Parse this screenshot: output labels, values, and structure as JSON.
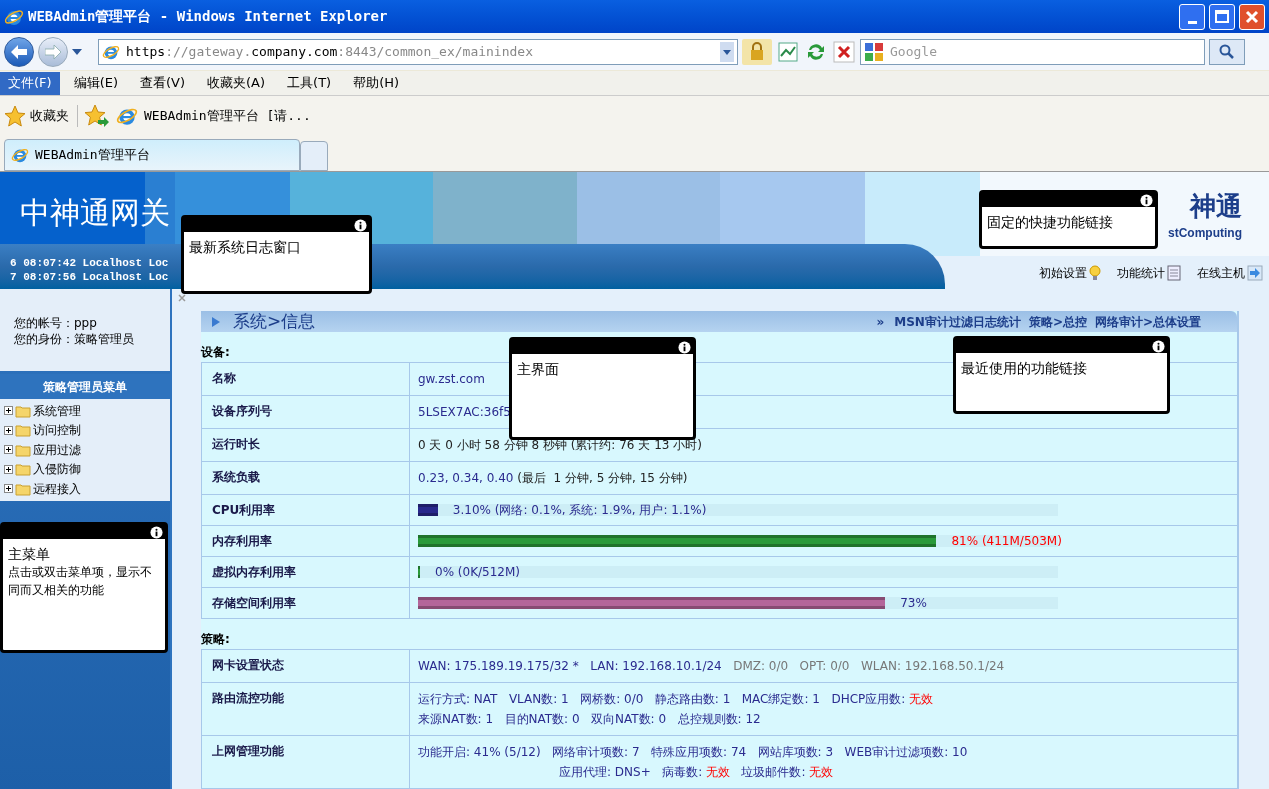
{
  "window": {
    "title": "WEBAdmin管理平台 - Windows Internet Explorer"
  },
  "address": {
    "parts": [
      {
        "text": "https",
        "dim": false
      },
      {
        "text": "://gateway.",
        "dim": true
      },
      {
        "text": "company.com",
        "dim": false
      },
      {
        "text": ":8443/common_ex/mainindex",
        "dim": true
      }
    ]
  },
  "search": {
    "placeholder": "Google"
  },
  "menu": [
    {
      "label": "文件(F)",
      "selected": true
    },
    {
      "label": "编辑(E)",
      "selected": false
    },
    {
      "label": "查看(V)",
      "selected": false
    },
    {
      "label": "收藏夹(A)",
      "selected": false
    },
    {
      "label": "工具(T)",
      "selected": false
    },
    {
      "label": "帮助(H)",
      "selected": false
    }
  ],
  "favorites_bar": {
    "label": "收藏夹",
    "link": "WEBAdmin管理平台 [请..."
  },
  "tabs": [
    {
      "label": "WEBAdmin管理平台",
      "selected": true
    }
  ],
  "header": {
    "brand": "中神通网关",
    "log_lines": [
      "6 08:07:42 Localhost Loc",
      "7 08:07:56 Localhost Loc"
    ],
    "logo_mark": "神通",
    "logo_text": "stComputing",
    "quick_links": [
      {
        "label": "初始设置",
        "kind": "bulb"
      },
      {
        "label": "功能统计",
        "kind": "doc"
      },
      {
        "label": "在线主机",
        "kind": "arrow"
      }
    ]
  },
  "sidebar": {
    "account": [
      "您的帐号：ppp",
      "您的身份：策略管理员"
    ],
    "menu_title": "策略管理员菜单",
    "items": [
      {
        "label": "系统管理",
        "expanded": false
      },
      {
        "label": "访问控制",
        "expanded": false
      },
      {
        "label": "应用过滤",
        "expanded": false
      },
      {
        "label": "入侵防御",
        "expanded": false
      },
      {
        "label": "远程接入",
        "expanded": false
      }
    ]
  },
  "main": {
    "title": "系统>信息",
    "recent_marker": "»",
    "recent_links": [
      "MSN审计过滤日志统计",
      "策略>总控",
      "网络审计>总体设置"
    ],
    "sections": [
      {
        "heading": "设备:",
        "rows": [
          {
            "label": "名称",
            "kind": "text",
            "lines": [
              {
                "segments": [
                  {
                    "text": "gw.zst.com",
                    "kind": "value"
                  }
                ]
              }
            ]
          },
          {
            "label": "设备序列号",
            "kind": "text",
            "lines": [
              {
                "segments": [
                  {
                    "text": "5LSEX7AC:36f5",
                    "kind": "value"
                  }
                ]
              }
            ]
          },
          {
            "label": "运行时长",
            "kind": "text",
            "lines": [
              {
                "segments": [
                  {
                    "text": "0 天 0 小时 58 分钟 8 秒钟 (累计约: 76 天 13 小时)",
                    "kind": "plain"
                  }
                ]
              }
            ]
          },
          {
            "label": "系统负载",
            "kind": "text",
            "lines": [
              {
                "segments": [
                  {
                    "text": "0.23, 0.34, 0.40",
                    "kind": "value"
                  },
                  {
                    "text": " (最后  1 分钟, 5 分钟, 15 分钟)",
                    "kind": "plain"
                  }
                ]
              }
            ]
          },
          {
            "label": "CPU利用率",
            "kind": "meter",
            "level": 0.031,
            "color": "#28288c",
            "reading": "3.10% (网络: 0.1%, 系统: 1.9%, 用户: 1.1%)",
            "alert": false
          },
          {
            "label": "内存利用率",
            "kind": "meter",
            "level": 0.81,
            "color": "#2a9a3a",
            "reading": "81% (411M/503M)",
            "alert": true
          },
          {
            "label": "虚拟内存利用率",
            "kind": "meter",
            "level": 0.0,
            "color": "#2a9a3a",
            "reading": "0% (0K/512M)",
            "alert": false
          },
          {
            "label": "存储空间利用率",
            "kind": "meter",
            "level": 0.73,
            "color": "#b4669a",
            "reading": "73%",
            "alert": false
          }
        ]
      },
      {
        "heading": "策略:",
        "rows": [
          {
            "label": "网卡设置状态",
            "kind": "text",
            "lines": [
              {
                "segments": [
                  {
                    "text": "WAN: 175.189.19.175/32 *   LAN: 192.168.10.1/24",
                    "kind": "value"
                  },
                  {
                    "text": "   DMZ: 0/0   OPT: 0/0   WLAN: 192.168.50.1/24",
                    "kind": "dim"
                  }
                ]
              }
            ]
          },
          {
            "label": "路由流控功能",
            "kind": "text",
            "lines": [
              {
                "segments": [
                  {
                    "text": "运行方式: NAT   VLAN数: 1   网桥数: 0/0   静态路由数: 1   MAC绑定数: 1   DHCP应用数: ",
                    "kind": "value"
                  },
                  {
                    "text": "无效",
                    "kind": "alert"
                  }
                ]
              },
              {
                "segments": [
                  {
                    "text": "来源NAT数: 1   目的NAT数: 0   双向NAT数: 0   总控规则数: 12",
                    "kind": "value"
                  }
                ]
              }
            ]
          },
          {
            "label": "上网管理功能",
            "kind": "text",
            "lines": [
              {
                "segments": [
                  {
                    "text": "功能开启: 41% (5/12)   网络审计项数: 7   特殊应用项数: 74   网站库项数: 3   WEB审计过滤项数: 10",
                    "kind": "value"
                  }
                ]
              },
              {
                "indent": true,
                "segments": [
                  {
                    "text": "应用代理: DNS+   病毒数: ",
                    "kind": "value"
                  },
                  {
                    "text": "无效",
                    "kind": "alert"
                  },
                  {
                    "text": "   垃圾邮件数: ",
                    "kind": "value"
                  },
                  {
                    "text": "无效",
                    "kind": "alert"
                  }
                ]
              }
            ]
          }
        ]
      }
    ]
  },
  "callouts": [
    {
      "text": "最新系统日志窗口"
    },
    {
      "text": "固定的快捷功能链接"
    },
    {
      "text": "主界面"
    },
    {
      "text": "最近使用的功能链接"
    },
    {
      "text": "主菜单",
      "detail": "点击或双击菜单项，显示不同而又相关的功能"
    }
  ]
}
